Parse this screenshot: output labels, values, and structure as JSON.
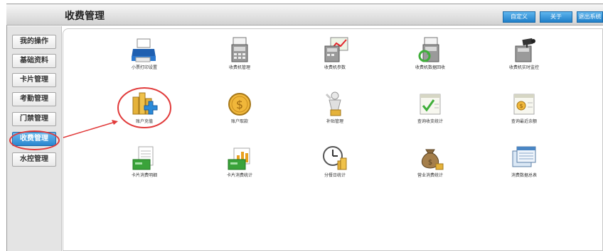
{
  "title": "收费管理",
  "top_buttons": [
    "自定义",
    "关于",
    "退出系统"
  ],
  "sidebar": {
    "items": [
      {
        "label": "我的操作",
        "active": false
      },
      {
        "label": "基础资料",
        "active": false
      },
      {
        "label": "卡片管理",
        "active": false
      },
      {
        "label": "考勤管理",
        "active": false
      },
      {
        "label": "门禁管理",
        "active": false
      },
      {
        "label": "收费管理",
        "active": true
      },
      {
        "label": "水控管理",
        "active": false
      }
    ]
  },
  "tiles": [
    {
      "label": "小票打印设置",
      "icon": "printer-icon"
    },
    {
      "label": "收费机管理",
      "icon": "pos-terminal-icon"
    },
    {
      "label": "收费机参数",
      "icon": "terminal-chart-icon"
    },
    {
      "label": "收费机数据回收",
      "icon": "data-recycle-icon"
    },
    {
      "label": "收费机实时监控",
      "icon": "monitor-camera-icon"
    },
    {
      "label": "账户充值",
      "icon": "coins-plus-icon"
    },
    {
      "label": "账户取款",
      "icon": "dollar-coin-icon"
    },
    {
      "label": "补贴管理",
      "icon": "subsidy-icon"
    },
    {
      "label": "查询收支统计",
      "icon": "income-expense-icon"
    },
    {
      "label": "查询最近余额",
      "icon": "balance-query-icon"
    },
    {
      "label": "卡片消费明细",
      "icon": "card-detail-icon"
    },
    {
      "label": "卡片消费统计",
      "icon": "card-stat-icon"
    },
    {
      "label": "分餐日统计",
      "icon": "clock-coins-icon"
    },
    {
      "label": "营业消费统计",
      "icon": "money-bag-icon"
    },
    {
      "label": "消费数据总表",
      "icon": "data-table-icon"
    }
  ]
}
